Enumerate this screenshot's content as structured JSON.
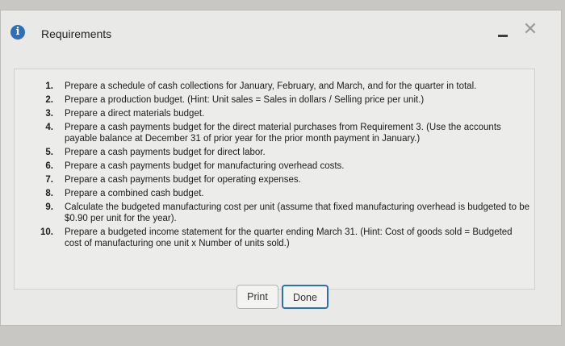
{
  "dialog": {
    "title": "Requirements",
    "minimize_icon": "minimize-icon",
    "close_icon": "close-icon",
    "info_icon": "info-icon"
  },
  "requirements": [
    {
      "num": "1.",
      "text": "Prepare a schedule of cash collections for January, February, and March, and for the quarter in total."
    },
    {
      "num": "2.",
      "text": "Prepare a production budget. (Hint: Unit sales = Sales in dollars / Selling price per unit.)"
    },
    {
      "num": "3.",
      "text": "Prepare a direct materials budget."
    },
    {
      "num": "4.",
      "text": "Prepare a cash payments budget for the direct material purchases from Requirement 3. (Use the accounts payable balance at December 31 of prior year for the prior month payment in January.)"
    },
    {
      "num": "5.",
      "text": "Prepare a cash payments budget for direct labor."
    },
    {
      "num": "6.",
      "text": "Prepare a cash payments budget for manufacturing overhead costs."
    },
    {
      "num": "7.",
      "text": "Prepare a cash payments budget for operating expenses."
    },
    {
      "num": "8.",
      "text": "Prepare a combined cash budget."
    },
    {
      "num": "9.",
      "text": "Calculate the budgeted manufacturing cost per unit (assume that fixed manufacturing overhead is budgeted to be $0.90 per unit for the year)."
    },
    {
      "num": "10.",
      "text": "Prepare a budgeted income statement for the quarter ending March 31. (Hint: Cost of goods sold = Budgeted cost of manufacturing one unit x Number of units sold.)"
    }
  ],
  "buttons": {
    "print": "Print",
    "done": "Done"
  }
}
